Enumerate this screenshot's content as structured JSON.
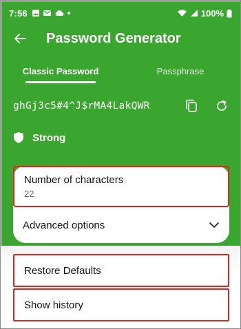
{
  "status_bar": {
    "time": "7:56",
    "left_icons": [
      "image-icon",
      "email-icon",
      "cloud-icon",
      "dot-icon"
    ],
    "right_icons": [
      "wifi-icon",
      "signal-icon"
    ],
    "battery": "100%"
  },
  "app_bar": {
    "title": "Password Generator"
  },
  "tabs": [
    {
      "label": "Classic Password",
      "active": true
    },
    {
      "label": "Passphrase",
      "active": false
    }
  ],
  "password": {
    "value": "ghGj3c5#4^J$rMA4LakQWR"
  },
  "strength": {
    "label": "Strong"
  },
  "settings": {
    "number_of_characters": {
      "label": "Number of characters",
      "value": "22"
    },
    "advanced_options": {
      "label": "Advanced options"
    }
  },
  "actions": {
    "restore_defaults": "Restore Defaults",
    "show_history": "Show history"
  },
  "colors": {
    "primary": "#3aa52f",
    "highlight": "#e0241c"
  }
}
